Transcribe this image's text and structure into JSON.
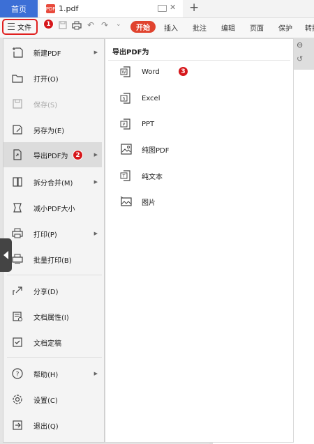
{
  "tabs": {
    "home": "首页",
    "document": "1.pdf",
    "pdf_badge": "PDF"
  },
  "toolbar": {
    "file_label": "文件",
    "ribbon": [
      "开始",
      "插入",
      "批注",
      "编辑",
      "页面",
      "保护",
      "转换"
    ]
  },
  "annotations": [
    "1",
    "2",
    "3"
  ],
  "file_menu": {
    "items": [
      {
        "label": "新建PDF",
        "icon": "new-pdf-icon",
        "submenu": true
      },
      {
        "label": "打开(O)",
        "icon": "folder-open-icon"
      },
      {
        "label": "保存(S)",
        "icon": "save-icon",
        "disabled": true
      },
      {
        "label": "另存为(E)",
        "icon": "save-as-icon"
      },
      {
        "label": "导出PDF为",
        "icon": "export-icon",
        "submenu": true,
        "active": true
      },
      {
        "label": "拆分合并(M)",
        "icon": "split-merge-icon",
        "submenu": true
      },
      {
        "label": "减小PDF大小",
        "icon": "compress-icon"
      },
      {
        "label": "打印(P)",
        "icon": "print-icon",
        "submenu": true
      },
      {
        "label": "批量打印(B)",
        "icon": "batch-print-icon"
      },
      {
        "label": "分享(D)",
        "icon": "share-icon"
      },
      {
        "label": "文档属性(I)",
        "icon": "properties-icon"
      },
      {
        "label": "文档定稿",
        "icon": "finalize-icon"
      },
      {
        "label": "帮助(H)",
        "icon": "help-icon",
        "submenu": true
      },
      {
        "label": "设置(C)",
        "icon": "settings-icon"
      },
      {
        "label": "退出(Q)",
        "icon": "exit-icon"
      }
    ]
  },
  "export_menu": {
    "title": "导出PDF为",
    "items": [
      {
        "label": "Word",
        "icon": "word-icon",
        "letter": "W"
      },
      {
        "label": "Excel",
        "icon": "excel-icon",
        "letter": "S"
      },
      {
        "label": "PPT",
        "icon": "ppt-icon",
        "letter": "P"
      },
      {
        "label": "纯图PDF",
        "icon": "image-pdf-icon"
      },
      {
        "label": "纯文本",
        "icon": "text-icon",
        "letter": "T"
      },
      {
        "label": "图片",
        "icon": "picture-icon"
      }
    ]
  },
  "colors": {
    "accent_blue": "#3c6fd6",
    "start_tab": "#e0432e",
    "highlight_red": "#e0201f"
  }
}
